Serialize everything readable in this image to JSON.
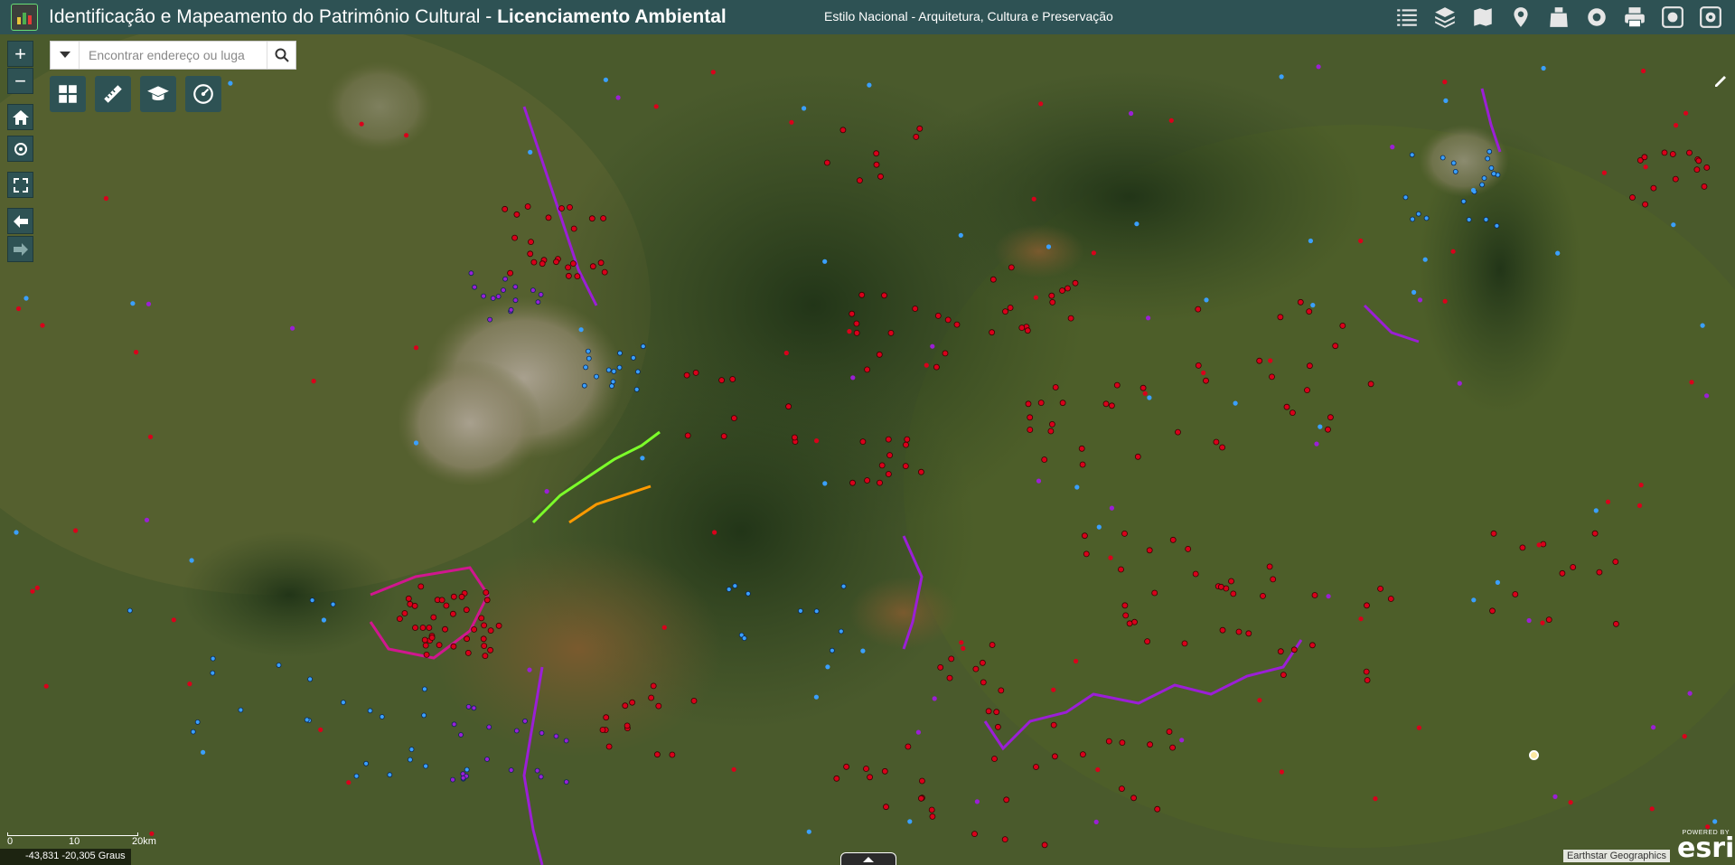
{
  "header": {
    "title_main": "Identificação e Mapeamento do Patrimônio Cultural - ",
    "title_bold": "Licenciamento Ambiental",
    "subtitle": "Estilo Nacional - Arquitetura, Cultura e Preservação"
  },
  "toolbar": {
    "icons": [
      "list-icon",
      "layers-icon",
      "bookmark-map-icon",
      "location-pin-icon",
      "basemap-icon",
      "gallery-icon",
      "print-icon",
      "settings-icon",
      "info-icon"
    ]
  },
  "search": {
    "placeholder": "Encontrar endereço ou luga"
  },
  "navigation": {
    "zoom_in": "+",
    "zoom_out": "−"
  },
  "scale": {
    "labels": [
      "0",
      "10",
      "20km"
    ]
  },
  "coordinates": {
    "text": "-43,831 -20,305 Graus"
  },
  "attribution": {
    "text": "Earthstar Geographics"
  },
  "esri": {
    "powered": "POWERED BY",
    "brand": "esri"
  },
  "colors": {
    "header_bg": "#2e5254",
    "site_red": "#d9001b",
    "site_blue": "#3aa0ff",
    "route_purple": "#9b1fd6",
    "route_magenta": "#d0178f",
    "route_orange": "#ff9a00",
    "route_green": "#7cff2a"
  }
}
